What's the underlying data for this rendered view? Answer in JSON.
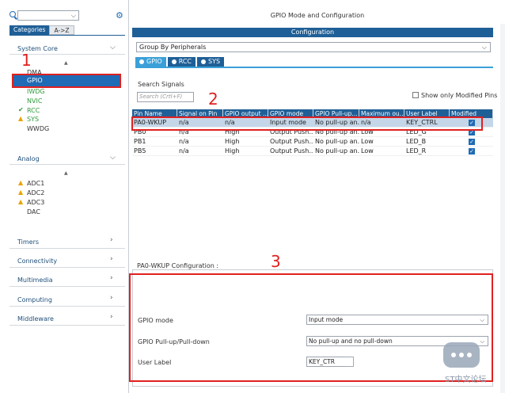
{
  "left_panel": {
    "search_value": "",
    "tabs": [
      "Categories",
      "A->Z"
    ],
    "groups": {
      "system_core": "System Core",
      "analog": "Analog",
      "timers": "Timers",
      "connectivity": "Connectivity",
      "multimedia": "Multimedia",
      "computing": "Computing",
      "middleware": "Middleware"
    },
    "system_core_items": [
      "DMA",
      "GPIO",
      "IWDG",
      "NVIC",
      "RCC",
      "SYS",
      "WWDG"
    ],
    "analog_items": [
      "ADC1",
      "ADC2",
      "ADC3",
      "DAC"
    ]
  },
  "main": {
    "title": "GPIO Mode and Configuration",
    "config_bar": "Configuration",
    "group_by": "Group By Peripherals",
    "tabs": [
      "GPIO",
      "RCC",
      "SYS"
    ],
    "search_label": "Search Signals",
    "search_placeholder": "Search (Crtl+F)",
    "modified_only": "Show only Modified Pins"
  },
  "table": {
    "headers": [
      "Pin Name",
      "Signal on Pin",
      "GPIO output ...",
      "GPIO mode",
      "GPIO Pull-up...",
      "Maximum ou...",
      "User Label",
      "Modified"
    ],
    "rows": [
      [
        "PA0-WKUP",
        "n/a",
        "n/a",
        "Input mode",
        "No pull-up an...",
        "n/a",
        "KEY_CTRL"
      ],
      [
        "PB0",
        "n/a",
        "High",
        "Output Push...",
        "No pull-up an...",
        "Low",
        "LED_G"
      ],
      [
        "PB1",
        "n/a",
        "High",
        "Output Push...",
        "No pull-up an...",
        "Low",
        "LED_B"
      ],
      [
        "PB5",
        "n/a",
        "High",
        "Output Push...",
        "No pull-up an...",
        "Low",
        "LED_R"
      ]
    ]
  },
  "pin_config": {
    "title": "PA0-WKUP Configuration :",
    "gpio_mode_label": "GPIO mode",
    "gpio_mode_value": "Input mode",
    "pull_label": "GPIO Pull-up/Pull-down",
    "pull_value": "No pull-up and no pull-down",
    "user_label_label": "User Label",
    "user_label_value": "KEY_CTR"
  },
  "annotations": [
    "1",
    "2",
    "3"
  ],
  "watermark": "ST中文论坛",
  "colors": {
    "accent": "#1f5f97",
    "highlight": "#1f6bb5",
    "annotation": "#e02020"
  }
}
